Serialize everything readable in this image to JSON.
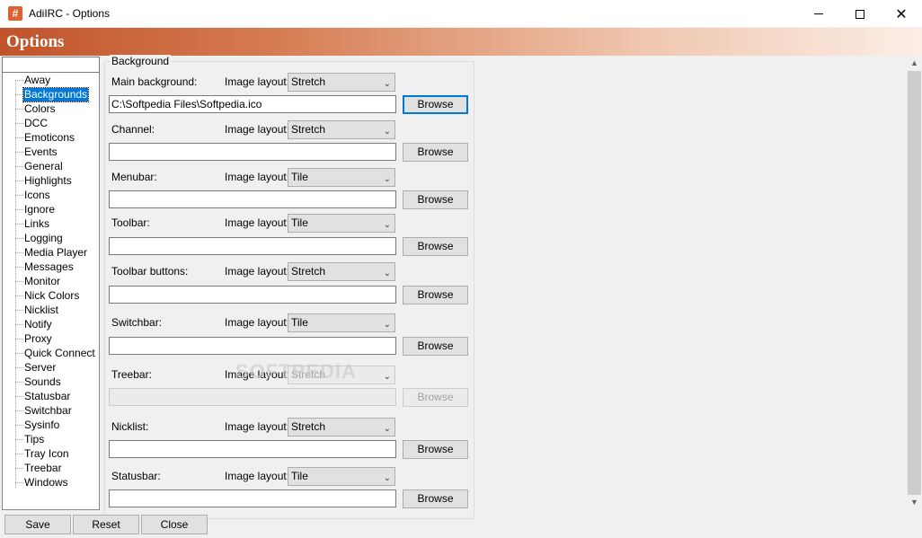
{
  "window": {
    "title": "AdiIRC - Options",
    "icon_glyph": "#",
    "close_glyph": "✕"
  },
  "banner": {
    "title": "Options"
  },
  "tree": {
    "search_value": "",
    "selected": "Backgrounds",
    "items": [
      "Away",
      "Backgrounds",
      "Colors",
      "DCC",
      "Emoticons",
      "Events",
      "General",
      "Highlights",
      "Icons",
      "Ignore",
      "Links",
      "Logging",
      "Media Player",
      "Messages",
      "Monitor",
      "Nick Colors",
      "Nicklist",
      "Notify",
      "Proxy",
      "Quick Connect",
      "Server",
      "Sounds",
      "Statusbar",
      "Switchbar",
      "Sysinfo",
      "Tips",
      "Tray Icon",
      "Treebar",
      "Windows"
    ]
  },
  "background_group": {
    "title": "Background",
    "layout_label": "Image layout:",
    "browse_label": "Browse",
    "rows": [
      {
        "label": "Main background:",
        "layout": "Stretch",
        "path": "C:\\Softpedia Files\\Softpedia.ico",
        "enabled": true
      },
      {
        "label": "Channel:",
        "layout": "Stretch",
        "path": "",
        "enabled": true
      },
      {
        "label": "Menubar:",
        "layout": "Tile",
        "path": "",
        "enabled": true
      },
      {
        "label": "Toolbar:",
        "layout": "Tile",
        "path": "",
        "enabled": true
      },
      {
        "label": "Toolbar buttons:",
        "layout": "Stretch",
        "path": "",
        "enabled": true
      },
      {
        "label": "Switchbar:",
        "layout": "Tile",
        "path": "",
        "enabled": true
      },
      {
        "label": "Treebar:",
        "layout": "Stretch",
        "path": "",
        "enabled": false
      },
      {
        "label": "Nicklist:",
        "layout": "Stretch",
        "path": "",
        "enabled": true
      },
      {
        "label": "Statusbar:",
        "layout": "Tile",
        "path": "",
        "enabled": true
      }
    ]
  },
  "watermark": "SOFTPEDIA",
  "footer": {
    "save_label": "Save",
    "reset_label": "Reset",
    "close_label": "Close"
  },
  "colors": {
    "accent": "#0078d7",
    "banner_start": "#c0532a",
    "banner_end": "#fbeee6"
  }
}
